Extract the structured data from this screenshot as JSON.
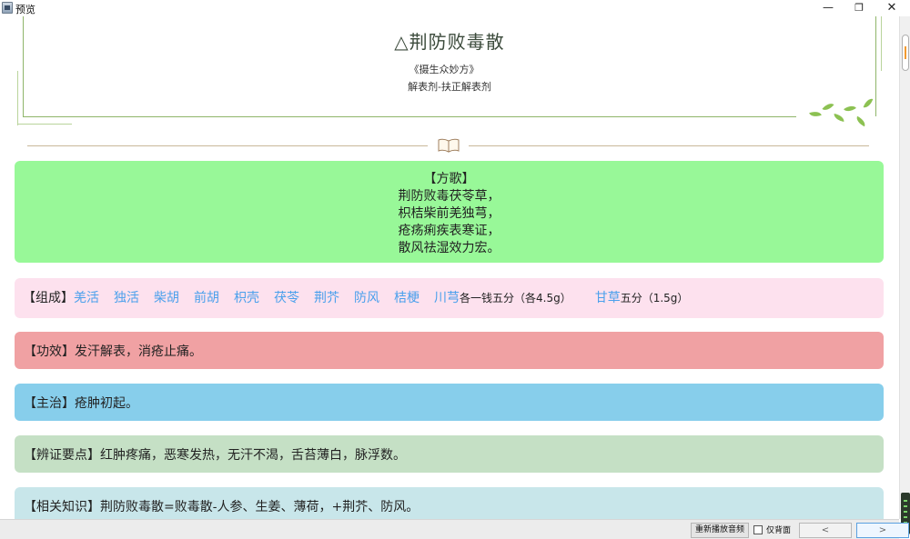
{
  "window": {
    "title": "预览",
    "minimize_icon": "minimize-icon",
    "maximize_icon": "restore-icon",
    "close_icon": "close-icon",
    "minimize_glyph": "—",
    "maximize_glyph": "❐",
    "close_glyph": "✕"
  },
  "header": {
    "title": "△荆防败毒散",
    "source": "《摄生众妙方》",
    "category": "解表剂-扶正解表剂"
  },
  "sections": {
    "song": {
      "heading": "【方歌】",
      "lines": [
        "荆防败毒茯苓草，",
        "枳桔柴前羌独芎，",
        "疮疡痢疾表寒证，",
        "散风祛湿效力宏。"
      ],
      "color": "#98f898"
    },
    "composition": {
      "label": "【组成】",
      "herbs": [
        "羌活",
        "独活",
        "柴胡",
        "前胡",
        "枳壳",
        "茯苓",
        "荆芥",
        "防风",
        "桔梗",
        "川芎"
      ],
      "dose_main": "各一钱五分（各4.5g）",
      "herb_extra": "甘草",
      "dose_extra": "五分（1.5g）",
      "herb_color": "#4aa0ec",
      "color": "#fde1ee"
    },
    "effect": {
      "label": "【功效】",
      "text": "发汗解表，消疮止痛。",
      "color": "#f0a1a3"
    },
    "indication": {
      "label": "【主治】",
      "text": "疮肿初起。",
      "color": "#87ceeb"
    },
    "diagnosis": {
      "label": "【辨证要点】",
      "text": "红肿疼痛，恶寒发热，无汗不渴，舌苔薄白，脉浮数。",
      "color": "#c5e0c5"
    },
    "related": {
      "label": "【相关知识】",
      "text": "荆防败毒散=败毒散-人参、生姜、薄荷，+荆芥、防风。",
      "color": "#c8e6ea"
    }
  },
  "footer": {
    "replay_label": "重新播放音频",
    "background_only_label": "仅背面",
    "prev_label": "<",
    "next_label": ">"
  },
  "icons": {
    "book": "open-book-icon"
  }
}
